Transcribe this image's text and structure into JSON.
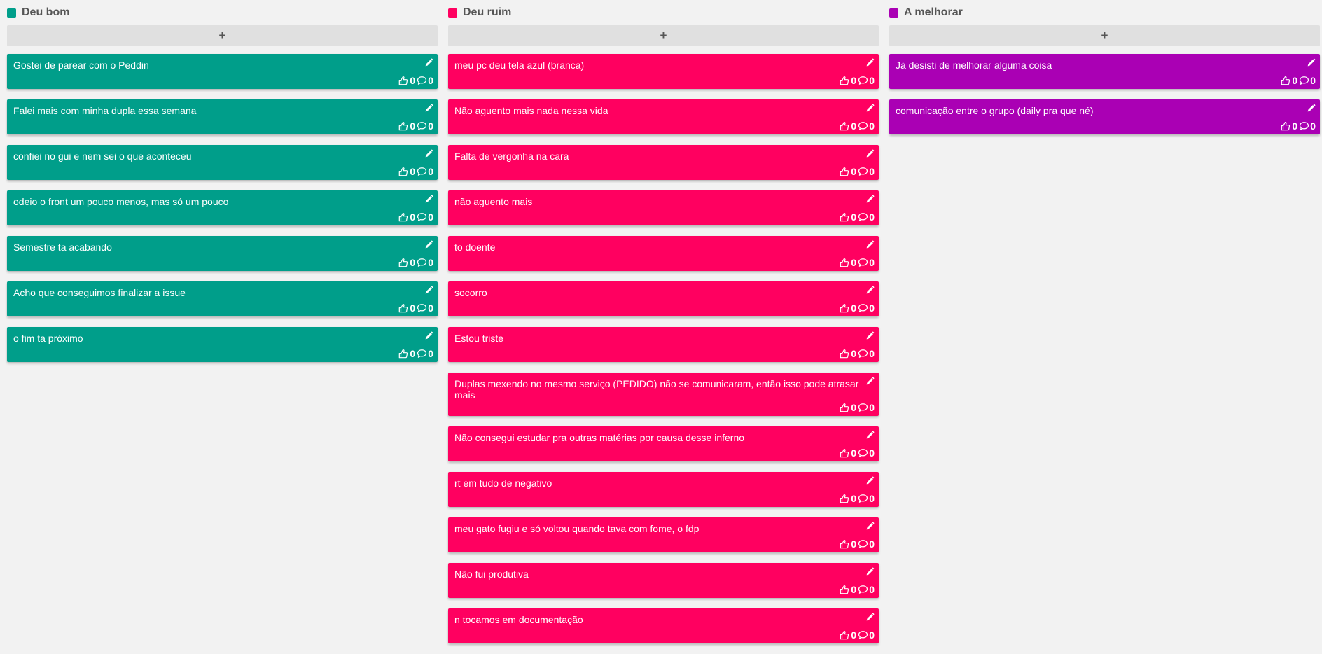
{
  "columns": [
    {
      "title": "Deu bom",
      "color": "#009e8a",
      "add_label": "+",
      "cards": [
        {
          "text": "Gostei de parear com o Peddin",
          "likes": "0",
          "comments": "0"
        },
        {
          "text": "Falei mais com minha dupla essa semana",
          "likes": "0",
          "comments": "0"
        },
        {
          "text": "confiei no gui e nem sei o que aconteceu",
          "likes": "0",
          "comments": "0"
        },
        {
          "text": "odeio o front um pouco menos, mas só um pouco",
          "likes": "0",
          "comments": "0"
        },
        {
          "text": "Semestre ta acabando",
          "likes": "0",
          "comments": "0"
        },
        {
          "text": "Acho que conseguimos finalizar a issue",
          "likes": "0",
          "comments": "0"
        },
        {
          "text": "o fim ta próximo",
          "likes": "0",
          "comments": "0"
        }
      ]
    },
    {
      "title": "Deu ruim",
      "color": "#ff0060",
      "add_label": "+",
      "cards": [
        {
          "text": "meu pc deu tela azul (branca)",
          "likes": "0",
          "comments": "0"
        },
        {
          "text": "Não aguento mais nada nessa vida",
          "likes": "0",
          "comments": "0"
        },
        {
          "text": "Falta de vergonha na cara",
          "likes": "0",
          "comments": "0"
        },
        {
          "text": "não aguento mais",
          "likes": "0",
          "comments": "0"
        },
        {
          "text": "to doente",
          "likes": "0",
          "comments": "0"
        },
        {
          "text": "socorro",
          "likes": "0",
          "comments": "0"
        },
        {
          "text": "Estou triste",
          "likes": "0",
          "comments": "0"
        },
        {
          "text": "Duplas mexendo no mesmo serviço (PEDIDO) não se comunicaram, então isso pode atrasar mais",
          "likes": "0",
          "comments": "0"
        },
        {
          "text": "Não consegui estudar pra outras matérias por causa desse inferno",
          "likes": "0",
          "comments": "0"
        },
        {
          "text": "rt em tudo de negativo",
          "likes": "0",
          "comments": "0"
        },
        {
          "text": "meu gato fugiu e só voltou quando tava com fome, o fdp",
          "likes": "0",
          "comments": "0"
        },
        {
          "text": "Não fui produtiva",
          "likes": "0",
          "comments": "0"
        },
        {
          "text": "n tocamos em documentação",
          "likes": "0",
          "comments": "0"
        }
      ]
    },
    {
      "title": "A melhorar",
      "color": "#aa00b4",
      "add_label": "+",
      "cards": [
        {
          "text": "Já desisti de melhorar alguma coisa",
          "likes": "0",
          "comments": "0"
        },
        {
          "text": "comunicação entre o grupo (daily pra que né)",
          "likes": "0",
          "comments": "0"
        }
      ]
    }
  ],
  "icons": {
    "edit": "pencil-icon",
    "like": "thumbs-up-icon",
    "comment": "comment-icon"
  }
}
